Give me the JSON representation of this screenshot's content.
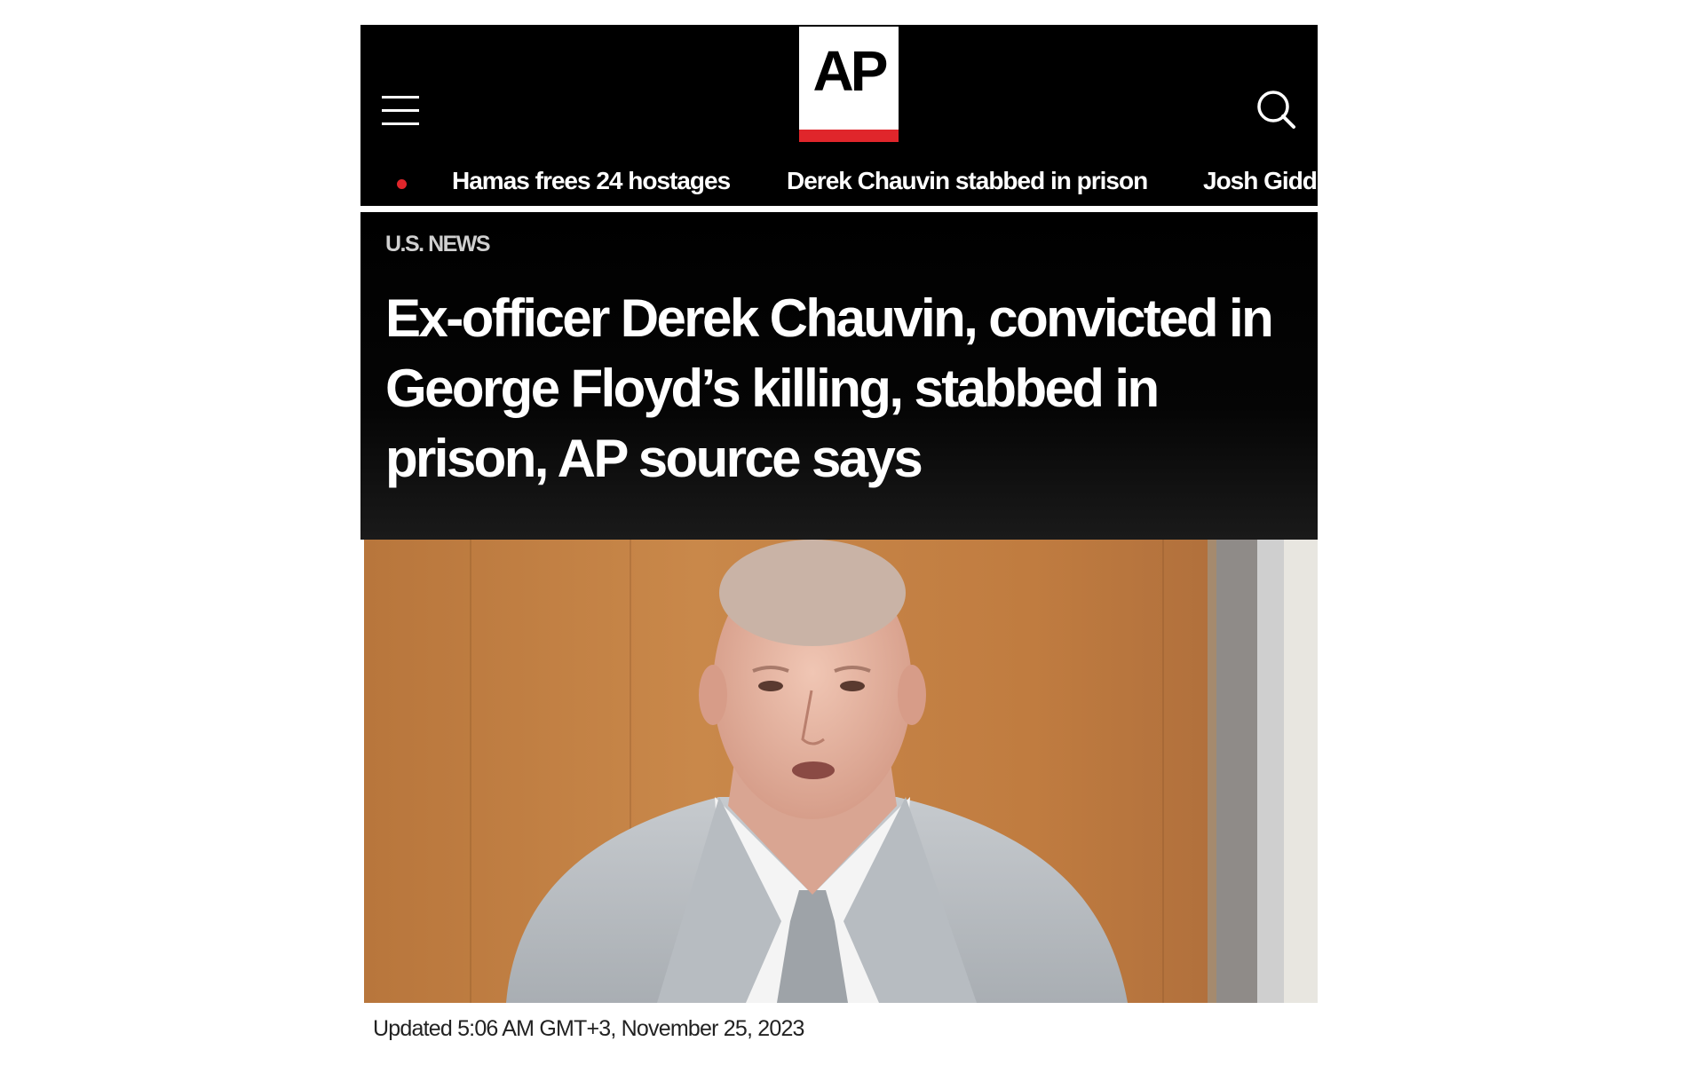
{
  "header": {
    "menu_icon": "hamburger-menu-icon",
    "logo_text": "AP",
    "search_icon": "search-icon",
    "colors": {
      "background": "#000000",
      "accent": "#e0262b",
      "text": "#ffffff"
    }
  },
  "ticker": {
    "live_indicator": "red-dot-icon",
    "items": [
      {
        "label": "Hamas frees 24 hostages"
      },
      {
        "label": "Derek Chauvin stabbed in prison"
      },
      {
        "label": "Josh Gidd"
      }
    ]
  },
  "article": {
    "section": "U.S. NEWS",
    "headline": "Ex-officer Derek Chauvin, convicted in George Floyd’s killing, stabbed in prison, AP source says",
    "image": "photo-of-man-in-gray-suit",
    "updated": "Updated 5:06 AM GMT+3, November 25, 2023"
  }
}
